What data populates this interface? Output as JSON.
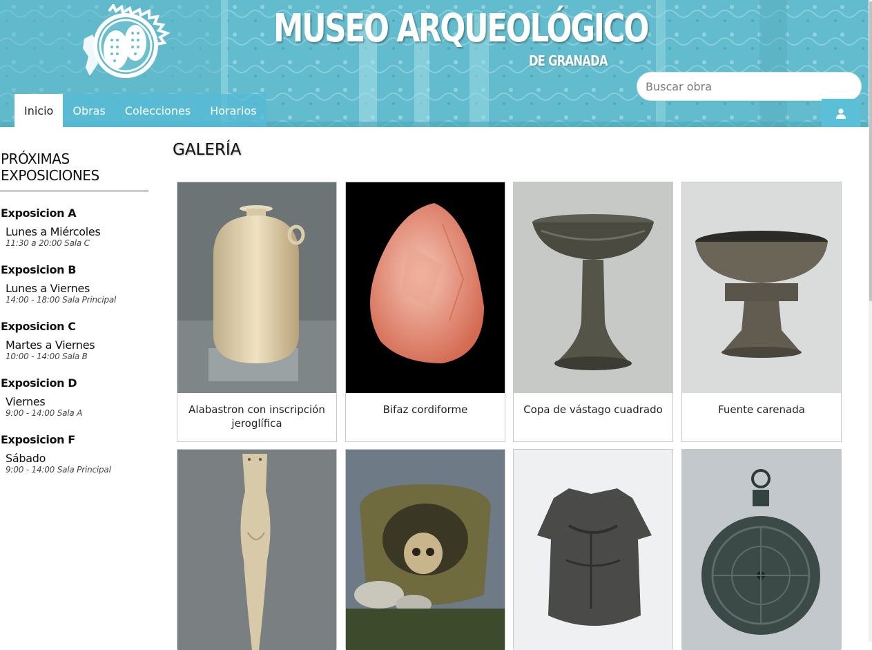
{
  "header": {
    "title": "MUSEO ARQUEOLÓGICO",
    "subtitle": "DE GRANADA",
    "search_placeholder": "Buscar obra",
    "bg_color": "#63bccd"
  },
  "nav": {
    "tabs": [
      {
        "label": "Inicio",
        "active": true
      },
      {
        "label": "Obras"
      },
      {
        "label": "Colecciones"
      },
      {
        "label": "Horarios"
      }
    ],
    "user_icon": "user-icon"
  },
  "sidebar": {
    "title_line1": "PRÓXIMAS",
    "title_line2": "EXPOSICIONES",
    "exhibitions": [
      {
        "name": "Exposicion A",
        "days": "Lunes a Miércoles",
        "time": "11:30 a 20:00 Sala C"
      },
      {
        "name": "Exposicion B",
        "days": "Lunes a Viernes",
        "time": "14:00 - 18:00 Sala Principal"
      },
      {
        "name": "Exposicion C",
        "days": "Martes a Viernes",
        "time": "10:00 - 14:00 Sala B"
      },
      {
        "name": "Exposicion D",
        "days": "Viernes",
        "time": "9:00 - 14:00 Sala A"
      },
      {
        "name": "Exposicion F",
        "days": "Sábado",
        "time": "9:00 - 14:00 Sala Principal"
      }
    ]
  },
  "gallery": {
    "title": "GALERÍA",
    "items": [
      {
        "caption": "Alabastron con inscripción jeroglífica",
        "image": "alabaster-jar"
      },
      {
        "caption": "Bifaz cordiforme",
        "image": "handaxe"
      },
      {
        "caption": "Copa de vástago cuadrado",
        "image": "stem-cup"
      },
      {
        "caption": "Fuente carenada",
        "image": "carinated-bowl"
      },
      {
        "caption": "",
        "image": "idol-figure"
      },
      {
        "caption": "",
        "image": "burial-urn"
      },
      {
        "caption": "",
        "image": "bronze-cuirass"
      },
      {
        "caption": "",
        "image": "astrolabe"
      }
    ]
  }
}
